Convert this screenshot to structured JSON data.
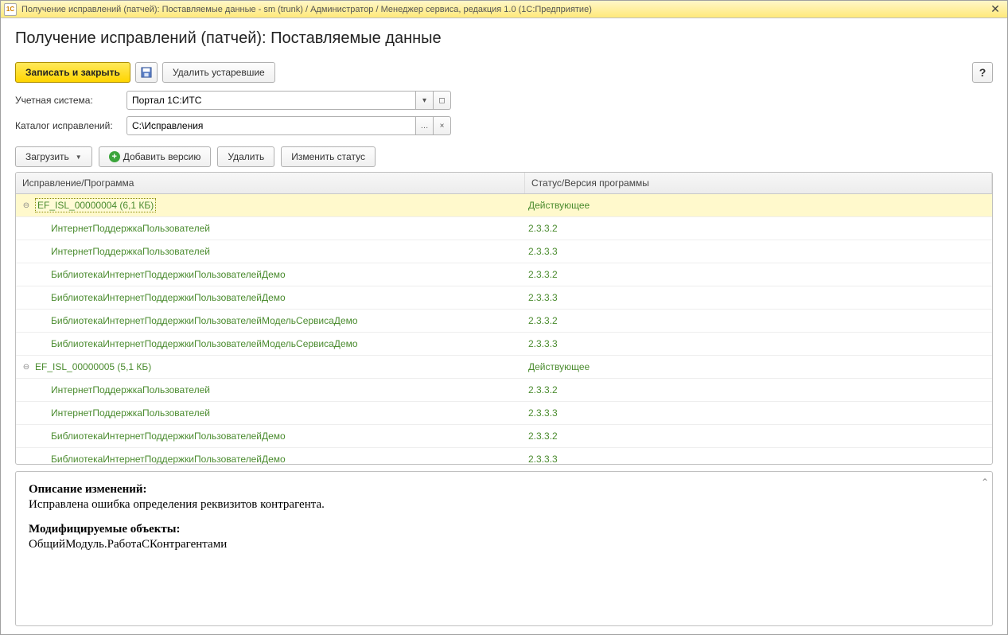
{
  "window": {
    "title": "Получение исправлений (патчей): Поставляемые данные - sm (trunk) / Администратор / Менеджер сервиса, редакция 1.0  (1С:Предприятие)",
    "icon_label": "1C"
  },
  "page": {
    "title": "Получение исправлений (патчей): Поставляемые данные"
  },
  "toolbar": {
    "save_close": "Записать и закрыть",
    "delete_old": "Удалить устаревшие",
    "help": "?"
  },
  "form": {
    "account_system_label": "Учетная система:",
    "account_system_value": "Портал 1С:ИТС",
    "catalog_label": "Каталог исправлений:",
    "catalog_value": "C:\\Исправления"
  },
  "actions": {
    "load": "Загрузить",
    "add_version": "Добавить версию",
    "delete": "Удалить",
    "change_status": "Изменить статус"
  },
  "grid": {
    "header_col1": "Исправление/Программа",
    "header_col2": "Статус/Версия программы",
    "rows": [
      {
        "level": 0,
        "expanded": true,
        "selected": true,
        "c1": "EF_ISL_00000004 (6,1 КБ)",
        "c2": "Действующее"
      },
      {
        "level": 1,
        "c1": "ИнтернетПоддержкаПользователей",
        "c2": "2.3.3.2"
      },
      {
        "level": 1,
        "c1": "ИнтернетПоддержкаПользователей",
        "c2": "2.3.3.3"
      },
      {
        "level": 1,
        "c1": "БиблиотекаИнтернетПоддержкиПользователейДемо",
        "c2": "2.3.3.2"
      },
      {
        "level": 1,
        "c1": "БиблиотекаИнтернетПоддержкиПользователейДемо",
        "c2": "2.3.3.3"
      },
      {
        "level": 1,
        "c1": "БиблиотекаИнтернетПоддержкиПользователейМодельСервисаДемо",
        "c2": "2.3.3.2"
      },
      {
        "level": 1,
        "c1": "БиблиотекаИнтернетПоддержкиПользователейМодельСервисаДемо",
        "c2": "2.3.3.3"
      },
      {
        "level": 0,
        "expanded": true,
        "c1": "EF_ISL_00000005 (5,1 КБ)",
        "c2": "Действующее"
      },
      {
        "level": 1,
        "c1": "ИнтернетПоддержкаПользователей",
        "c2": "2.3.3.2"
      },
      {
        "level": 1,
        "c1": "ИнтернетПоддержкаПользователей",
        "c2": "2.3.3.3"
      },
      {
        "level": 1,
        "c1": "БиблиотекаИнтернетПоддержкиПользователейДемо",
        "c2": "2.3.3.2"
      },
      {
        "level": 1,
        "c1": "БиблиотекаИнтернетПоддержкиПользователейДемо",
        "c2": "2.3.3.3"
      }
    ]
  },
  "description": {
    "heading1": "Описание изменений:",
    "text1": "Исправлена ошибка определения реквизитов контрагента.",
    "heading2": "Модифицируемые объекты:",
    "text2": "ОбщийМодуль.РаботаСКонтрагентами"
  }
}
